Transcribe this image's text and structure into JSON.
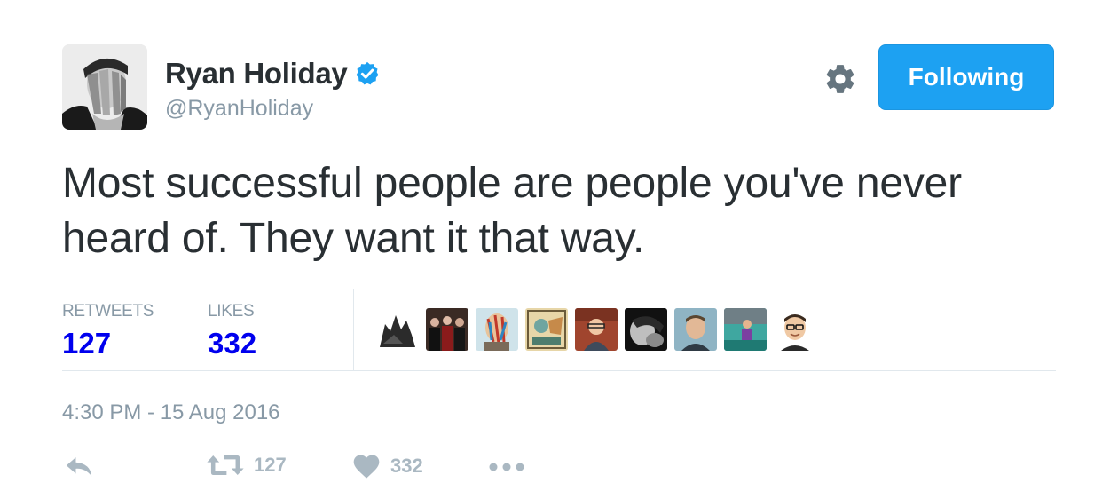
{
  "author": {
    "name": "Ryan Holiday",
    "handle": "@RyanHoliday",
    "verified": true,
    "avatar_icon": "avatar-face-covered-photo"
  },
  "header": {
    "settings_icon": "gear-icon",
    "follow_button_label": "Following"
  },
  "tweet": {
    "text": "Most successful people are people you've never heard of. They want it that way."
  },
  "stats": {
    "retweets_label": "RETWEETS",
    "retweets_count": "127",
    "likes_label": "LIKES",
    "likes_count": "332"
  },
  "likers": [
    {
      "icon": "liker-avatar-photo"
    },
    {
      "icon": "liker-avatar-photo"
    },
    {
      "icon": "liker-avatar-photo"
    },
    {
      "icon": "liker-avatar-photo"
    },
    {
      "icon": "liker-avatar-photo"
    },
    {
      "icon": "liker-avatar-photo"
    },
    {
      "icon": "liker-avatar-photo"
    },
    {
      "icon": "liker-avatar-photo"
    },
    {
      "icon": "liker-avatar-photo"
    }
  ],
  "timestamp": "4:30 PM - 15 Aug 2016",
  "actions": {
    "reply_icon": "reply-icon",
    "retweet_icon": "retweet-icon",
    "retweet_count": "127",
    "like_icon": "heart-icon",
    "like_count": "332",
    "more_icon": "more-dots-icon"
  },
  "colors": {
    "accent": "#1da1f2",
    "verified": "#1da1f2",
    "muted_text": "#8899a6",
    "stat_value": "#0000ee",
    "action_icon": "#aab8c2"
  }
}
